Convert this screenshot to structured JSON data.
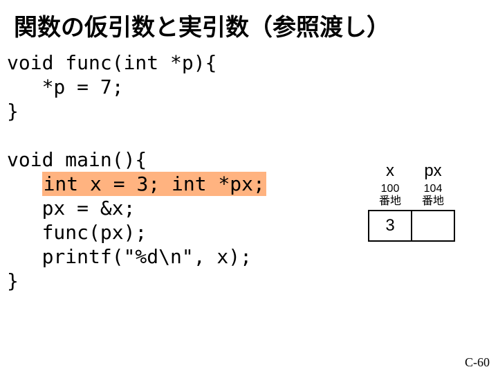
{
  "title": "関数の仮引数と実引数（参照渡し）",
  "code": {
    "l1": "void func(int *p){",
    "l2": "   *p = 7;",
    "l3": "}",
    "l4": "",
    "l5": "void main(){",
    "l6a": "   ",
    "l6b": "int x = 3; int *px;",
    "l7": "   px = &x;",
    "l8": "   func(px);",
    "l9": "   printf(\"%d\\n\", x);",
    "l10": "}"
  },
  "diagram": {
    "col1_hdr": "x",
    "col2_hdr": "px",
    "col1_addr1": "100",
    "col1_addr2": "番地",
    "col2_addr1": "104",
    "col2_addr2": "番地",
    "cell1": "3",
    "cell2": ""
  },
  "footer": "C-60"
}
